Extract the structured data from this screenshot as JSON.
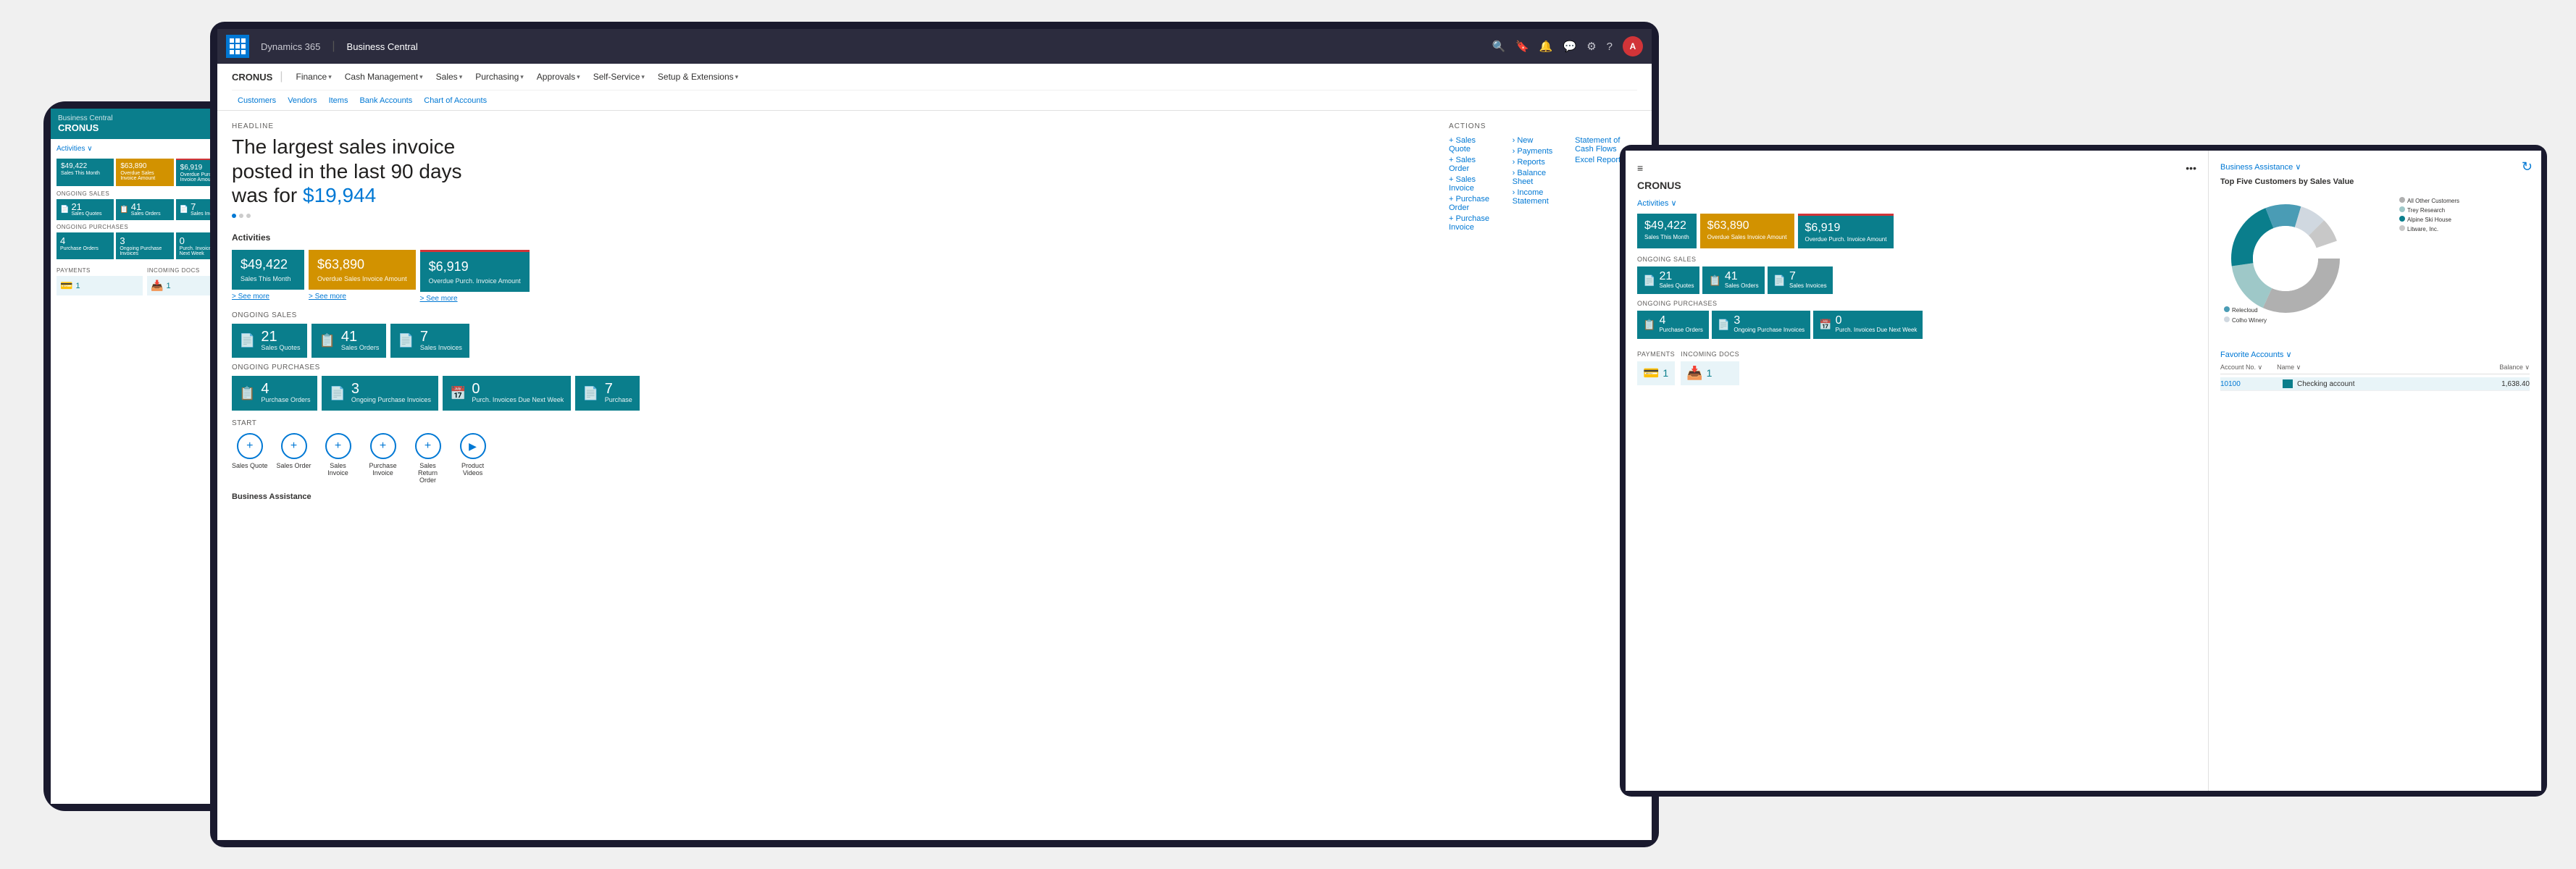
{
  "app": {
    "dynamics_label": "Dynamics 365",
    "bc_label": "Business Central",
    "waffle_aria": "App launcher"
  },
  "nav_icons": [
    "🔍",
    "🔔",
    "💬",
    "⚙",
    "?"
  ],
  "nav_avatar": "A",
  "menu": {
    "company": "CRONUS",
    "items": [
      "Finance",
      "Cash Management",
      "Sales",
      "Purchasing",
      "Approvals",
      "Self-Service",
      "Setup & Extensions"
    ],
    "breadcrumbs": [
      "Customers",
      "Vendors",
      "Items",
      "Bank Accounts",
      "Chart of Accounts"
    ]
  },
  "headline": {
    "label": "HEADLINE",
    "text_part1": "The largest sales invoice",
    "text_part2": "posted in the last 90 days",
    "text_part3": "was for ",
    "amount": "$19,944"
  },
  "activities": {
    "label": "Activities",
    "tiles": [
      {
        "amount": "$49,422",
        "label": "Sales This Month",
        "type": "teal"
      },
      {
        "amount": "$63,890",
        "label": "Overdue Sales Invoice Amount",
        "type": "yellow"
      },
      {
        "amount": "$6,919",
        "label": "Overdue Purch. Invoice Amount",
        "type": "red-top"
      }
    ],
    "see_more": "> See more"
  },
  "ongoing_sales": {
    "label": "ONGOING SALES",
    "tiles": [
      {
        "icon": "📄",
        "count": "21",
        "label": "Sales Quotes"
      },
      {
        "icon": "📋",
        "count": "41",
        "label": "Sales Orders"
      },
      {
        "icon": "📄",
        "count": "7",
        "label": "Sales Invoices"
      }
    ]
  },
  "ongoing_purchases": {
    "label": "ONGOING PURCHASES",
    "tiles": [
      {
        "icon": "📋",
        "count": "4",
        "label": "Purchase Orders"
      },
      {
        "icon": "📄",
        "count": "3",
        "label": "Ongoing Purchase Invoices"
      },
      {
        "icon": "📅",
        "count": "0",
        "label": "Purch. Invoices Due Next Week"
      },
      {
        "icon": "📄",
        "count": "7",
        "label": "Purchase"
      }
    ]
  },
  "actions": {
    "label": "ACTIONS",
    "create_links": [
      "+ Sales Quote",
      "+ Sales Order",
      "+ Sales Invoice",
      "+ Purchase Order",
      "+ Purchase Invoice"
    ],
    "sub_links": [
      "› New",
      "› Payments",
      "› Reports",
      "› Balance Sheet",
      "› Income Statement"
    ],
    "right_links": [
      "Statement of Cash Flows",
      "Excel Reports"
    ]
  },
  "start": {
    "label": "START",
    "items": [
      "Sales Quote",
      "Sales Order",
      "Sales Invoice",
      "Purchase Invoice",
      "Sales Return Order",
      "Product Videos"
    ]
  },
  "business_assistance": {
    "label": "Business Assistance"
  },
  "tablet": {
    "company": "CRONUS",
    "activities_label": "Activities ∨",
    "tiles": [
      {
        "amount": "$49,422",
        "label": "Sales This Month"
      },
      {
        "amount": "$63,890",
        "label": "Overdue Sales Invoice Amount"
      },
      {
        "amount": "$6,919",
        "label": "Overdue Purch. Invoice Amount"
      }
    ],
    "ongoing_sales_label": "ONGOING SALES",
    "sales_tiles": [
      {
        "count": "21",
        "label": "Sales Quotes"
      },
      {
        "count": "41",
        "label": "Sales Orders"
      },
      {
        "count": "7",
        "label": "Sales Invoices"
      }
    ],
    "ongoing_purchases_label": "ONGOING PURCHASES",
    "purchase_tiles": [
      {
        "count": "4",
        "label": "Purchase Orders"
      },
      {
        "count": "3",
        "label": "Ongoing Purchase Invoices"
      },
      {
        "count": "0",
        "label": "Purch. Invoices Due Next Week"
      }
    ],
    "payments_label": "PAYMENTS",
    "incoming_label": "INCOMING DOCS",
    "chart_title": "Top Five Customers by Sales Value",
    "favorite_accounts_label": "Favorite Accounts ∨",
    "ba_label": "Business Assistance ∨",
    "legend": [
      {
        "name": "All Other Customers",
        "color": "#b0b0b0"
      },
      {
        "name": "Trey Research",
        "color": "#9ec8c8"
      },
      {
        "name": "Alpine Ski House",
        "color": "#0a7e8c"
      },
      {
        "name": "Relecloud",
        "color": "#4a9cb5"
      },
      {
        "name": "Colho Winery",
        "color": "#d0d8e0"
      },
      {
        "name": "Litware, Inc.",
        "color": "#c8c8c8"
      }
    ],
    "fa_headers": [
      "Account No. ∨",
      "Name ∨",
      "Balance ∨"
    ],
    "fa_rows": [
      {
        "acct": "10100",
        "bar": true,
        "name": "Checking account",
        "bal": "1,638.40"
      }
    ]
  },
  "phone": {
    "bc_label": "Business Central",
    "company": "CRONUS",
    "activities_label": "Activities ∨",
    "tiles": [
      {
        "amount": "$49,422",
        "label": "Sales This Month"
      },
      {
        "amount": "$63,890",
        "label": "Overdue Sales Invoice Amount"
      },
      {
        "amount": "$6,919",
        "label": "Overdue Purch. Invoice Amount"
      }
    ],
    "ongoing_sales_label": "ONGOING SALES",
    "sales_tiles": [
      {
        "count": "21",
        "label": "Sales Quotes"
      },
      {
        "count": "41",
        "label": "Sales Orders"
      },
      {
        "count": "7",
        "label": "Sales Invoices"
      }
    ],
    "ongoing_purchases_label": "ONGOING PURCHASES",
    "purchase_tiles": [
      {
        "count": "4",
        "label": "Purchase Orders"
      },
      {
        "count": "3",
        "label": "Ongoing Purchase Invoices"
      },
      {
        "count": "0",
        "label": "Purch. Invoices Due Next Week"
      }
    ],
    "payments_label": "PAYMENTS",
    "incoming_label": "INCOMING DOCS",
    "pay_count": "1",
    "incoming_count": "1"
  }
}
